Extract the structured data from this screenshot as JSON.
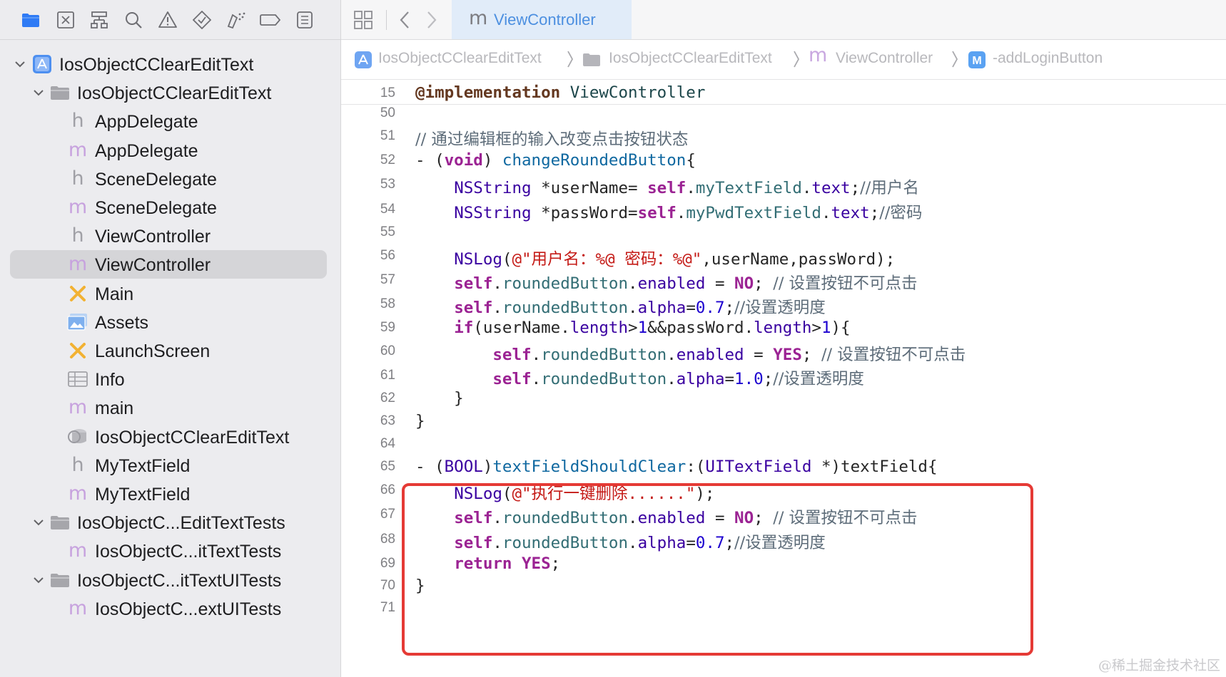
{
  "nav_toolbar": {
    "icons": [
      "folder-icon",
      "source-control-icon",
      "hierarchy-icon",
      "search-icon",
      "warning-icon",
      "test-icon",
      "debug-icon",
      "breakpoint-icon",
      "report-icon"
    ]
  },
  "project_tree": [
    {
      "label": "IosObjectCClearEditText",
      "icon": "xcode-project-icon",
      "level": 0,
      "expanded": true
    },
    {
      "label": "IosObjectCClearEditText",
      "icon": "folder-icon",
      "level": 1,
      "expanded": true
    },
    {
      "label": "AppDelegate",
      "icon": "h",
      "level": 2
    },
    {
      "label": "AppDelegate",
      "icon": "m",
      "level": 2
    },
    {
      "label": "SceneDelegate",
      "icon": "h",
      "level": 2
    },
    {
      "label": "SceneDelegate",
      "icon": "m",
      "level": 2
    },
    {
      "label": "ViewController",
      "icon": "h",
      "level": 2
    },
    {
      "label": "ViewController",
      "icon": "m",
      "level": 2,
      "selected": true
    },
    {
      "label": "Main",
      "icon": "storyboard-icon",
      "level": 2
    },
    {
      "label": "Assets",
      "icon": "assets-icon",
      "level": 2
    },
    {
      "label": "LaunchScreen",
      "icon": "storyboard-icon",
      "level": 2
    },
    {
      "label": "Info",
      "icon": "plist-icon",
      "level": 2
    },
    {
      "label": "main",
      "icon": "m",
      "level": 2
    },
    {
      "label": "IosObjectCClearEditText",
      "icon": "datamodel-icon",
      "level": 2
    },
    {
      "label": "MyTextField",
      "icon": "h",
      "level": 2
    },
    {
      "label": "MyTextField",
      "icon": "m",
      "level": 2
    },
    {
      "label": "IosObjectC...EditTextTests",
      "icon": "folder-icon",
      "level": 1,
      "expanded": true
    },
    {
      "label": "IosObjectC...itTextTests",
      "icon": "m",
      "level": 2
    },
    {
      "label": "IosObjectC...itTextUITests",
      "icon": "folder-icon",
      "level": 1,
      "expanded": true
    },
    {
      "label": "IosObjectC...extUITests",
      "icon": "m",
      "level": 2
    }
  ],
  "editor_tab": {
    "icon_letter": "m",
    "label": "ViewController"
  },
  "breadcrumb": [
    {
      "icon": "xcode-project-icon",
      "label": "IosObjectCClearEditText"
    },
    {
      "icon": "folder-icon",
      "label": "IosObjectCClearEditText"
    },
    {
      "icon": "m",
      "label": "ViewController"
    },
    {
      "icon": "M",
      "label": "-addLoginButton"
    }
  ],
  "sticky_header": {
    "line": "15",
    "segments": [
      {
        "t": "@implementation",
        "c": "c-impl"
      },
      {
        "t": " "
      },
      {
        "t": "ViewController",
        "c": "c-cls"
      }
    ]
  },
  "code_lines": [
    {
      "n": "50",
      "segments": []
    },
    {
      "n": "51",
      "segments": [
        {
          "t": "// 通过编辑框的输入改变点击按钮状态",
          "c": "c-cmt"
        }
      ]
    },
    {
      "n": "52",
      "segments": [
        {
          "t": "- ("
        },
        {
          "t": "void",
          "c": "c-kw"
        },
        {
          "t": ") "
        },
        {
          "t": "changeRoundedButton",
          "c": "c-func"
        },
        {
          "t": "{"
        }
      ]
    },
    {
      "n": "53",
      "segments": [
        {
          "t": "    "
        },
        {
          "t": "NSString",
          "c": "c-type"
        },
        {
          "t": " *userName= "
        },
        {
          "t": "self",
          "c": "c-kw"
        },
        {
          "t": "."
        },
        {
          "t": "myTextField",
          "c": "c-prop"
        },
        {
          "t": "."
        },
        {
          "t": "text",
          "c": "c-type"
        },
        {
          "t": ";"
        },
        {
          "t": "//用户名",
          "c": "c-cmt"
        }
      ]
    },
    {
      "n": "54",
      "segments": [
        {
          "t": "    "
        },
        {
          "t": "NSString",
          "c": "c-type"
        },
        {
          "t": " *passWord="
        },
        {
          "t": "self",
          "c": "c-kw"
        },
        {
          "t": "."
        },
        {
          "t": "myPwdTextField",
          "c": "c-prop"
        },
        {
          "t": "."
        },
        {
          "t": "text",
          "c": "c-type"
        },
        {
          "t": ";"
        },
        {
          "t": "//密码",
          "c": "c-cmt"
        }
      ]
    },
    {
      "n": "55",
      "segments": []
    },
    {
      "n": "56",
      "segments": [
        {
          "t": "    "
        },
        {
          "t": "NSLog",
          "c": "c-type"
        },
        {
          "t": "("
        },
        {
          "t": "@\"用户名：%@ 密码：%@\"",
          "c": "c-str"
        },
        {
          "t": ",userName,passWord);"
        }
      ]
    },
    {
      "n": "57",
      "segments": [
        {
          "t": "    "
        },
        {
          "t": "self",
          "c": "c-kw"
        },
        {
          "t": "."
        },
        {
          "t": "roundedButton",
          "c": "c-prop"
        },
        {
          "t": "."
        },
        {
          "t": "enabled",
          "c": "c-type"
        },
        {
          "t": " = "
        },
        {
          "t": "NO",
          "c": "c-kw"
        },
        {
          "t": "; "
        },
        {
          "t": "// 设置按钮不可点击",
          "c": "c-cmt"
        }
      ]
    },
    {
      "n": "58",
      "segments": [
        {
          "t": "    "
        },
        {
          "t": "self",
          "c": "c-kw"
        },
        {
          "t": "."
        },
        {
          "t": "roundedButton",
          "c": "c-prop"
        },
        {
          "t": "."
        },
        {
          "t": "alpha",
          "c": "c-type"
        },
        {
          "t": "="
        },
        {
          "t": "0.7",
          "c": "c-num"
        },
        {
          "t": ";"
        },
        {
          "t": "//设置透明度",
          "c": "c-cmt"
        }
      ]
    },
    {
      "n": "59",
      "segments": [
        {
          "t": "    "
        },
        {
          "t": "if",
          "c": "c-kw"
        },
        {
          "t": "(userName."
        },
        {
          "t": "length",
          "c": "c-type"
        },
        {
          "t": ">"
        },
        {
          "t": "1",
          "c": "c-num"
        },
        {
          "t": "&&passWord."
        },
        {
          "t": "length",
          "c": "c-type"
        },
        {
          "t": ">"
        },
        {
          "t": "1",
          "c": "c-num"
        },
        {
          "t": "){"
        }
      ]
    },
    {
      "n": "60",
      "segments": [
        {
          "t": "        "
        },
        {
          "t": "self",
          "c": "c-kw"
        },
        {
          "t": "."
        },
        {
          "t": "roundedButton",
          "c": "c-prop"
        },
        {
          "t": "."
        },
        {
          "t": "enabled",
          "c": "c-type"
        },
        {
          "t": " = "
        },
        {
          "t": "YES",
          "c": "c-kw"
        },
        {
          "t": "; "
        },
        {
          "t": "// 设置按钮不可点击",
          "c": "c-cmt"
        }
      ]
    },
    {
      "n": "61",
      "segments": [
        {
          "t": "        "
        },
        {
          "t": "self",
          "c": "c-kw"
        },
        {
          "t": "."
        },
        {
          "t": "roundedButton",
          "c": "c-prop"
        },
        {
          "t": "."
        },
        {
          "t": "alpha",
          "c": "c-type"
        },
        {
          "t": "="
        },
        {
          "t": "1.0",
          "c": "c-num"
        },
        {
          "t": ";"
        },
        {
          "t": "//设置透明度",
          "c": "c-cmt"
        }
      ]
    },
    {
      "n": "62",
      "segments": [
        {
          "t": "    }"
        }
      ]
    },
    {
      "n": "63",
      "segments": [
        {
          "t": "}"
        }
      ]
    },
    {
      "n": "64",
      "segments": []
    },
    {
      "n": "65",
      "segments": [
        {
          "t": "- ("
        },
        {
          "t": "BOOL",
          "c": "c-type"
        },
        {
          "t": ")"
        },
        {
          "t": "textFieldShouldClear",
          "c": "c-func"
        },
        {
          "t": ":("
        },
        {
          "t": "UITextField",
          "c": "c-type"
        },
        {
          "t": " *)textField{"
        }
      ]
    },
    {
      "n": "66",
      "segments": [
        {
          "t": "    "
        },
        {
          "t": "NSLog",
          "c": "c-type"
        },
        {
          "t": "("
        },
        {
          "t": "@\"执行一键删除......\"",
          "c": "c-str"
        },
        {
          "t": ");"
        }
      ]
    },
    {
      "n": "67",
      "segments": [
        {
          "t": "    "
        },
        {
          "t": "self",
          "c": "c-kw"
        },
        {
          "t": "."
        },
        {
          "t": "roundedButton",
          "c": "c-prop"
        },
        {
          "t": "."
        },
        {
          "t": "enabled",
          "c": "c-type"
        },
        {
          "t": " = "
        },
        {
          "t": "NO",
          "c": "c-kw"
        },
        {
          "t": "; "
        },
        {
          "t": "// 设置按钮不可点击",
          "c": "c-cmt"
        }
      ]
    },
    {
      "n": "68",
      "segments": [
        {
          "t": "    "
        },
        {
          "t": "self",
          "c": "c-kw"
        },
        {
          "t": "."
        },
        {
          "t": "roundedButton",
          "c": "c-prop"
        },
        {
          "t": "."
        },
        {
          "t": "alpha",
          "c": "c-type"
        },
        {
          "t": "="
        },
        {
          "t": "0.7",
          "c": "c-num"
        },
        {
          "t": ";"
        },
        {
          "t": "//设置透明度",
          "c": "c-cmt"
        }
      ]
    },
    {
      "n": "69",
      "segments": [
        {
          "t": "    "
        },
        {
          "t": "return",
          "c": "c-kw"
        },
        {
          "t": " "
        },
        {
          "t": "YES",
          "c": "c-kw"
        },
        {
          "t": ";"
        }
      ]
    },
    {
      "n": "70",
      "segments": [
        {
          "t": "}"
        }
      ]
    },
    {
      "n": "71",
      "segments": []
    }
  ],
  "watermark": "@稀土掘金技术社区",
  "colors": {
    "selection": "#d5d5d8",
    "highlight_border": "#e53a35",
    "tab_active": "#e1ecf9",
    "accent": "#2f7bf5"
  }
}
